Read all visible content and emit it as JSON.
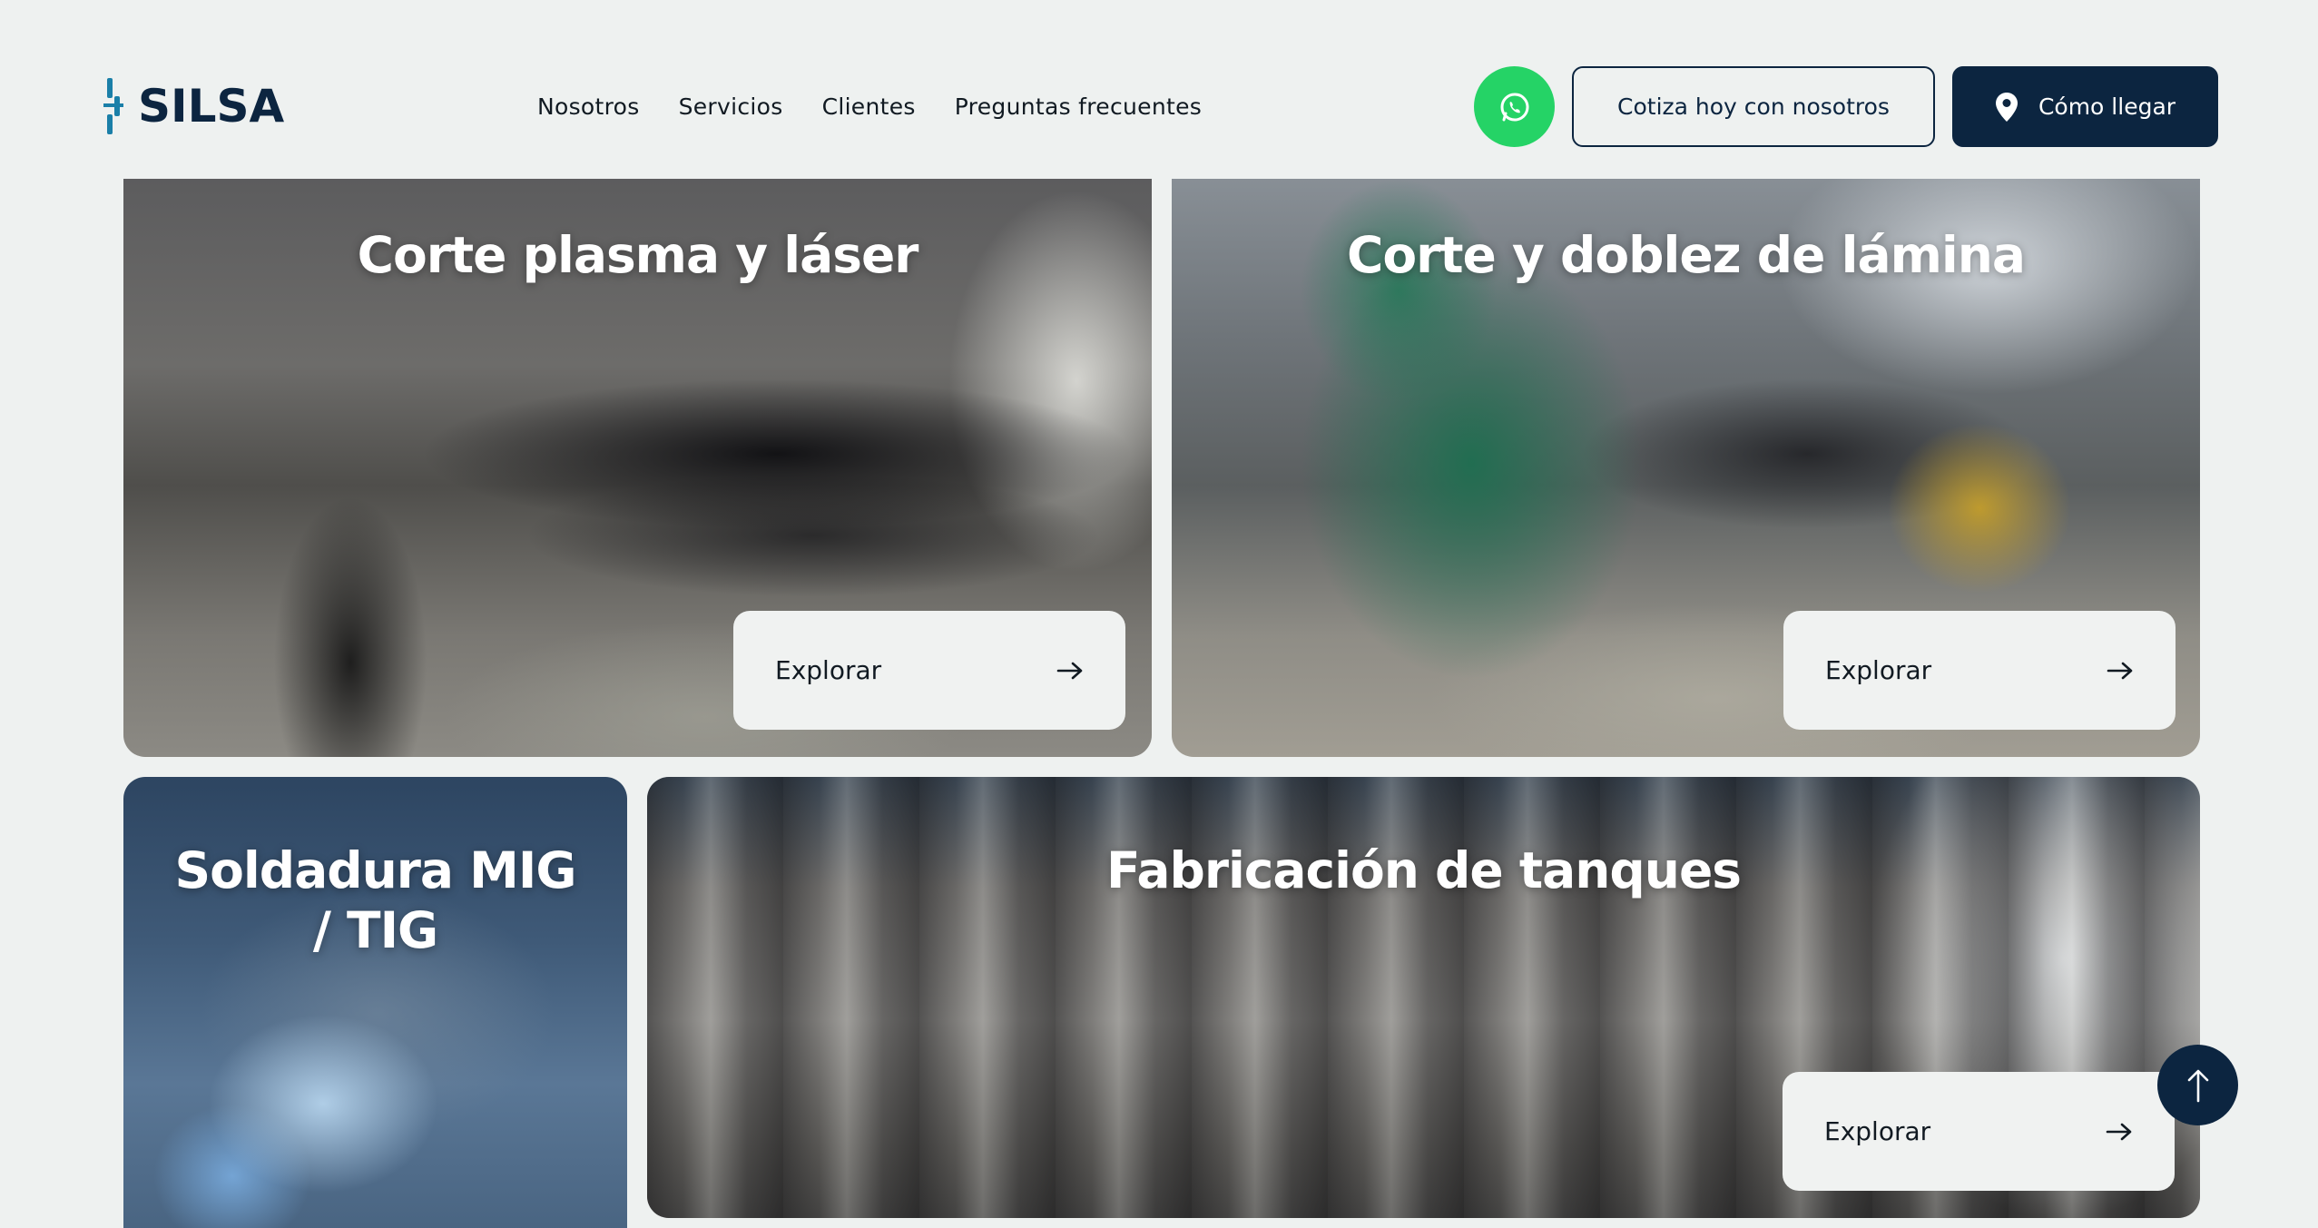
{
  "header": {
    "logo_text": "SILSA",
    "nav": [
      {
        "label": "Nosotros"
      },
      {
        "label": "Servicios"
      },
      {
        "label": "Clientes"
      },
      {
        "label": "Preguntas frecuentes"
      }
    ],
    "whatsapp_icon": "whatsapp-icon",
    "quote_label": "Cotiza hoy con nosotros",
    "directions_label": "Cómo llegar",
    "directions_icon": "map-pin-icon"
  },
  "services": [
    {
      "title": "Corte plasma y láser",
      "button_label": "Explorar"
    },
    {
      "title": "Corte y doblez de lámina",
      "button_label": "Explorar"
    },
    {
      "title": "Soldadura MIG / TIG"
    },
    {
      "title": "Fabricación de tanques",
      "button_label": "Explorar"
    }
  ],
  "colors": {
    "brand_navy": "#0c2540",
    "whatsapp_green": "#25d366",
    "background": "#eef1f0",
    "button_surface": "#f0f2f1"
  },
  "scroll_top_icon": "arrow-up-icon"
}
